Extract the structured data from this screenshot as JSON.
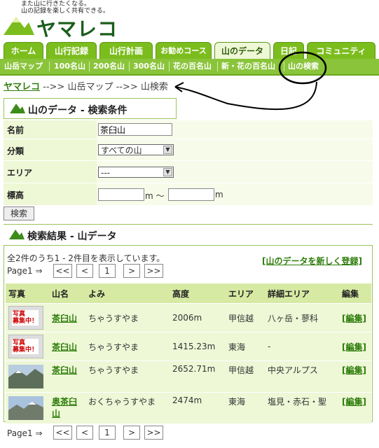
{
  "header": {
    "tagline": "また山に行きたくなる。\n山の記録を楽しく共有できる。",
    "logo_text": "ヤマレコ"
  },
  "tabs": [
    "ホーム",
    "山行記録",
    "山行計画",
    "お勧めコース",
    "山のデータ",
    "日記",
    "コミュニティ"
  ],
  "subnav": [
    "山岳マップ",
    "100名山",
    "200名山",
    "300名山",
    "花の百名山",
    "新・花の百名山",
    "山の検索"
  ],
  "breadcrumb": {
    "home": "ヤマレコ",
    "sep1": " -->> ",
    "map": "山岳マップ",
    "sep2": " -->> ",
    "current": "山検索"
  },
  "search": {
    "title": "山のデータ - 検索条件",
    "name_label": "名前",
    "name_value": "茶臼山",
    "class_label": "分類",
    "class_value": "すべての山",
    "area_label": "エリア",
    "area_value": "---",
    "elev_label": "標高",
    "elev_unit1": "m ～",
    "elev_unit2": "m",
    "submit": "検索"
  },
  "results": {
    "title": "検索結果 - 山データ",
    "summary": "全2件のうち1 - 2件目を表示しています。",
    "register_link": "[山のデータを新しく登録]",
    "page_label": "Page1 ⇒",
    "pager": [
      "<<",
      "<",
      "1",
      ">",
      ">>"
    ],
    "columns": [
      "写真",
      "山名",
      "よみ",
      "高度",
      "エリア",
      "詳細エリア",
      "編集"
    ],
    "rows": [
      {
        "photo": "placeholder",
        "photo_text": "写真\n募集中！",
        "name": "茶臼山",
        "yomi": "ちゃうすやま",
        "height": "2006m",
        "area": "甲信越",
        "detail": "八ヶ岳・蓼科",
        "edit": "[編集]"
      },
      {
        "photo": "placeholder",
        "photo_text": "写真\n募集中！",
        "name": "茶臼山",
        "yomi": "ちゃうすやま",
        "height": "1415.23m",
        "area": "東海",
        "detail": "-",
        "edit": "[編集]"
      },
      {
        "photo": "mountain",
        "photo_text": "",
        "name": "茶臼山",
        "yomi": "ちゃうすやま",
        "height": "2652.71m",
        "area": "甲信越",
        "detail": "中央アルプス",
        "edit": "[編集]"
      },
      {
        "photo": "mountain",
        "photo_text": "",
        "name": "奥茶臼山",
        "yomi": "おくちゃうすやま",
        "height": "2474m",
        "area": "東海",
        "detail": "塩見・赤石・聖",
        "edit": "[編集]"
      }
    ]
  },
  "colors": {
    "accent_green": "#7cbd1e",
    "row_bg": "#eef7d6",
    "annotation": "#000000"
  }
}
